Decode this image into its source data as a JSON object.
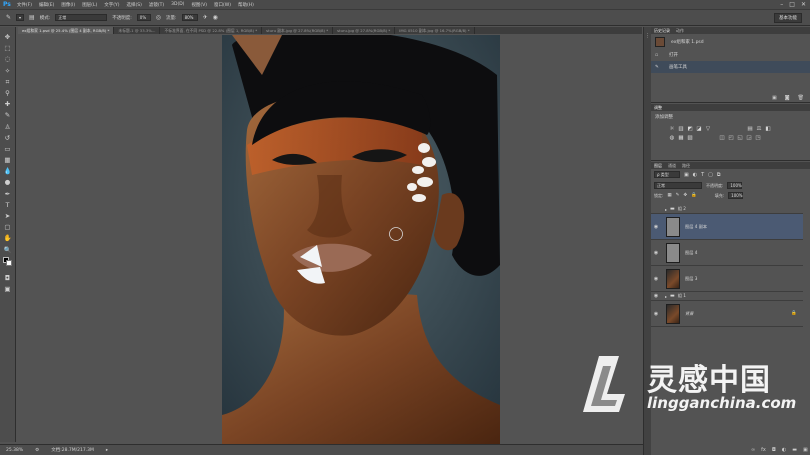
{
  "app": {
    "logo": "Ps"
  },
  "menu": [
    "文件(F)",
    "编辑(E)",
    "图像(I)",
    "图层(L)",
    "文字(Y)",
    "选择(S)",
    "滤镜(T)",
    "3D(D)",
    "视图(V)",
    "窗口(W)",
    "帮助(H)"
  ],
  "window_controls": {
    "minimize": "–",
    "maximize": "□",
    "close": "✕"
  },
  "options": {
    "mode_label": "模式:",
    "mode_value": "正常",
    "opacity_label": "不透明度:",
    "opacity_value": "0%",
    "flow_label": "流量:",
    "flow_value": "80%"
  },
  "workspace": "基本功能",
  "tabs": [
    {
      "label": "ex组和家 1.psd @ 25.4% (图层 4 副本, RGB/8) *",
      "active": true
    },
    {
      "label": "未标题-1 @ 33.3%...",
      "active": false
    },
    {
      "label": "不标准界面, 在不同 PSD @ 22.8% (图层 1, RGB/8) *",
      "active": false
    },
    {
      "label": "sturu 副本.jpg @ 27.8%(RGB/8) *",
      "active": false
    },
    {
      "label": "sturu.jpg @ 27.8%(RGB/8) *",
      "active": false
    },
    {
      "label": "IMG 0510 副本.jpg @ 16.7%(RGB/8) *",
      "active": false
    }
  ],
  "status": {
    "zoom": "25.38%",
    "doc": "文档:28.7M/217.3M"
  },
  "history_panel": {
    "tabs": [
      "历史记录",
      "动作"
    ],
    "snapshot": "ex组和家 1.psd",
    "items": [
      "打开",
      "画笔工具"
    ]
  },
  "adjustments_panel": {
    "tab": "调整",
    "title": "添加调整",
    "row1": [
      "☼",
      "▥",
      "◩",
      "◪",
      "▽"
    ],
    "row2": [
      "▤",
      "⚖",
      "◧",
      "◍",
      "▦",
      "▧"
    ],
    "row3": [
      "◫",
      "◰",
      "◱",
      "◲",
      "◳"
    ]
  },
  "layers_panel": {
    "tabs": [
      "图层",
      "通道",
      "路径"
    ],
    "kind_label": "ρ 类型",
    "blend": "正常",
    "opacity_label": "不透明度:",
    "opacity": "100%",
    "lock_label": "锁定:",
    "fill_label": "填充:",
    "fill": "100%",
    "layers": [
      {
        "name": "组 2",
        "type": "group"
      },
      {
        "name": "图层 4 副本",
        "type": "layer",
        "selected": true,
        "thumb": "gray"
      },
      {
        "name": "图层 4",
        "type": "layer",
        "thumb": "gray"
      },
      {
        "name": "图层 3",
        "type": "layer",
        "thumb": "photo"
      },
      {
        "name": "组 1",
        "type": "group"
      },
      {
        "name": "背景",
        "type": "layer",
        "thumb": "photo",
        "locked": true
      }
    ]
  },
  "watermark": {
    "title": "灵感中国",
    "url": "lingganchina.com"
  },
  "colors": {
    "accent_selection": "#4b5a73",
    "ps_blue": "#31a8ff"
  }
}
